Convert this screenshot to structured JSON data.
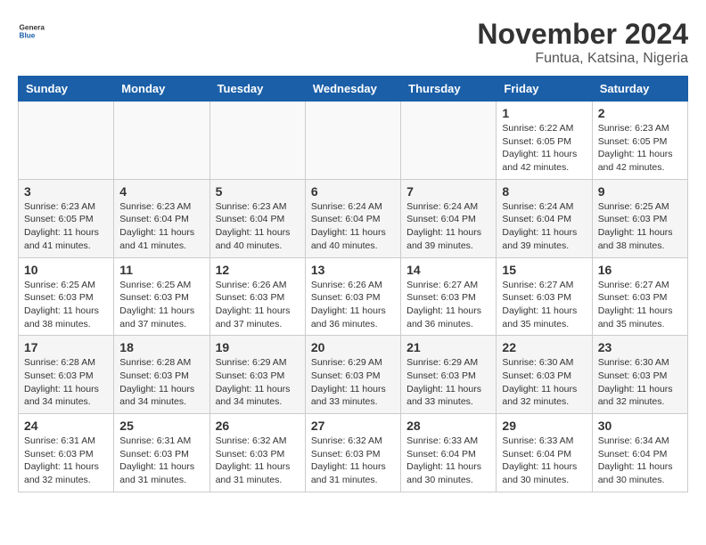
{
  "header": {
    "logo_general": "General",
    "logo_blue": "Blue",
    "month_title": "November 2024",
    "location": "Funtua, Katsina, Nigeria"
  },
  "days_of_week": [
    "Sunday",
    "Monday",
    "Tuesday",
    "Wednesday",
    "Thursday",
    "Friday",
    "Saturday"
  ],
  "weeks": [
    [
      {
        "day": "",
        "info": ""
      },
      {
        "day": "",
        "info": ""
      },
      {
        "day": "",
        "info": ""
      },
      {
        "day": "",
        "info": ""
      },
      {
        "day": "",
        "info": ""
      },
      {
        "day": "1",
        "info": "Sunrise: 6:22 AM\nSunset: 6:05 PM\nDaylight: 11 hours and 42 minutes."
      },
      {
        "day": "2",
        "info": "Sunrise: 6:23 AM\nSunset: 6:05 PM\nDaylight: 11 hours and 42 minutes."
      }
    ],
    [
      {
        "day": "3",
        "info": "Sunrise: 6:23 AM\nSunset: 6:05 PM\nDaylight: 11 hours and 41 minutes."
      },
      {
        "day": "4",
        "info": "Sunrise: 6:23 AM\nSunset: 6:04 PM\nDaylight: 11 hours and 41 minutes."
      },
      {
        "day": "5",
        "info": "Sunrise: 6:23 AM\nSunset: 6:04 PM\nDaylight: 11 hours and 40 minutes."
      },
      {
        "day": "6",
        "info": "Sunrise: 6:24 AM\nSunset: 6:04 PM\nDaylight: 11 hours and 40 minutes."
      },
      {
        "day": "7",
        "info": "Sunrise: 6:24 AM\nSunset: 6:04 PM\nDaylight: 11 hours and 39 minutes."
      },
      {
        "day": "8",
        "info": "Sunrise: 6:24 AM\nSunset: 6:04 PM\nDaylight: 11 hours and 39 minutes."
      },
      {
        "day": "9",
        "info": "Sunrise: 6:25 AM\nSunset: 6:03 PM\nDaylight: 11 hours and 38 minutes."
      }
    ],
    [
      {
        "day": "10",
        "info": "Sunrise: 6:25 AM\nSunset: 6:03 PM\nDaylight: 11 hours and 38 minutes."
      },
      {
        "day": "11",
        "info": "Sunrise: 6:25 AM\nSunset: 6:03 PM\nDaylight: 11 hours and 37 minutes."
      },
      {
        "day": "12",
        "info": "Sunrise: 6:26 AM\nSunset: 6:03 PM\nDaylight: 11 hours and 37 minutes."
      },
      {
        "day": "13",
        "info": "Sunrise: 6:26 AM\nSunset: 6:03 PM\nDaylight: 11 hours and 36 minutes."
      },
      {
        "day": "14",
        "info": "Sunrise: 6:27 AM\nSunset: 6:03 PM\nDaylight: 11 hours and 36 minutes."
      },
      {
        "day": "15",
        "info": "Sunrise: 6:27 AM\nSunset: 6:03 PM\nDaylight: 11 hours and 35 minutes."
      },
      {
        "day": "16",
        "info": "Sunrise: 6:27 AM\nSunset: 6:03 PM\nDaylight: 11 hours and 35 minutes."
      }
    ],
    [
      {
        "day": "17",
        "info": "Sunrise: 6:28 AM\nSunset: 6:03 PM\nDaylight: 11 hours and 34 minutes."
      },
      {
        "day": "18",
        "info": "Sunrise: 6:28 AM\nSunset: 6:03 PM\nDaylight: 11 hours and 34 minutes."
      },
      {
        "day": "19",
        "info": "Sunrise: 6:29 AM\nSunset: 6:03 PM\nDaylight: 11 hours and 34 minutes."
      },
      {
        "day": "20",
        "info": "Sunrise: 6:29 AM\nSunset: 6:03 PM\nDaylight: 11 hours and 33 minutes."
      },
      {
        "day": "21",
        "info": "Sunrise: 6:29 AM\nSunset: 6:03 PM\nDaylight: 11 hours and 33 minutes."
      },
      {
        "day": "22",
        "info": "Sunrise: 6:30 AM\nSunset: 6:03 PM\nDaylight: 11 hours and 32 minutes."
      },
      {
        "day": "23",
        "info": "Sunrise: 6:30 AM\nSunset: 6:03 PM\nDaylight: 11 hours and 32 minutes."
      }
    ],
    [
      {
        "day": "24",
        "info": "Sunrise: 6:31 AM\nSunset: 6:03 PM\nDaylight: 11 hours and 32 minutes."
      },
      {
        "day": "25",
        "info": "Sunrise: 6:31 AM\nSunset: 6:03 PM\nDaylight: 11 hours and 31 minutes."
      },
      {
        "day": "26",
        "info": "Sunrise: 6:32 AM\nSunset: 6:03 PM\nDaylight: 11 hours and 31 minutes."
      },
      {
        "day": "27",
        "info": "Sunrise: 6:32 AM\nSunset: 6:03 PM\nDaylight: 11 hours and 31 minutes."
      },
      {
        "day": "28",
        "info": "Sunrise: 6:33 AM\nSunset: 6:04 PM\nDaylight: 11 hours and 30 minutes."
      },
      {
        "day": "29",
        "info": "Sunrise: 6:33 AM\nSunset: 6:04 PM\nDaylight: 11 hours and 30 minutes."
      },
      {
        "day": "30",
        "info": "Sunrise: 6:34 AM\nSunset: 6:04 PM\nDaylight: 11 hours and 30 minutes."
      }
    ]
  ]
}
